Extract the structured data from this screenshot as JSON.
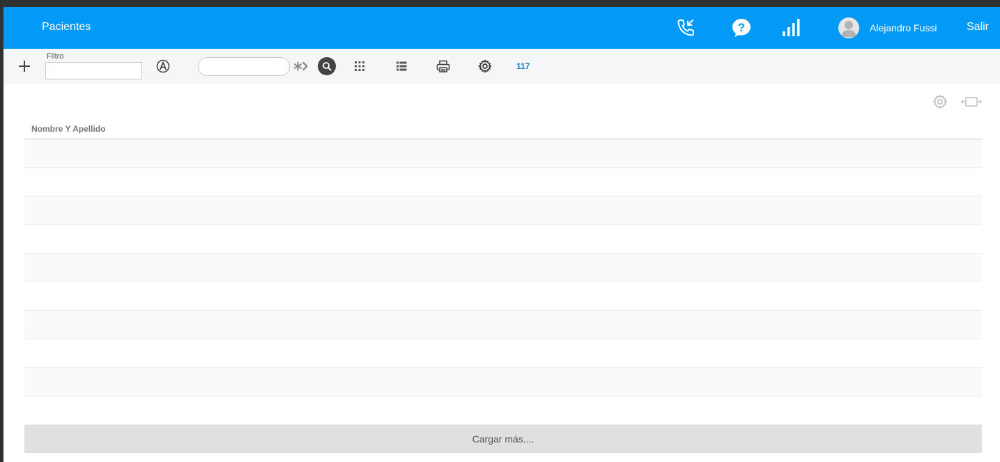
{
  "header": {
    "title": "Pacientes",
    "user_name": "Alejandro Fussi",
    "logout_label": "Salir",
    "icons": [
      "incoming-call-icon",
      "help-icon",
      "stats-icon"
    ],
    "background_color": "#0299f7"
  },
  "toolbar": {
    "filter_label": "Filtro",
    "filter_value": "",
    "search_value": "",
    "record_count": "117",
    "icons": [
      "add-icon",
      "alpha-icon",
      "advanced-search-icon",
      "search-icon",
      "grid-view-icon",
      "list-view-icon",
      "print-icon",
      "settings-icon"
    ]
  },
  "table": {
    "columns": [
      "Nombre Y Apellido"
    ],
    "rows": [
      {
        "name": ""
      },
      {
        "name": ""
      },
      {
        "name": ""
      },
      {
        "name": ""
      },
      {
        "name": ""
      },
      {
        "name": ""
      },
      {
        "name": ""
      },
      {
        "name": ""
      },
      {
        "name": ""
      },
      {
        "name": ""
      }
    ]
  },
  "load_more_label": "Cargar más...."
}
